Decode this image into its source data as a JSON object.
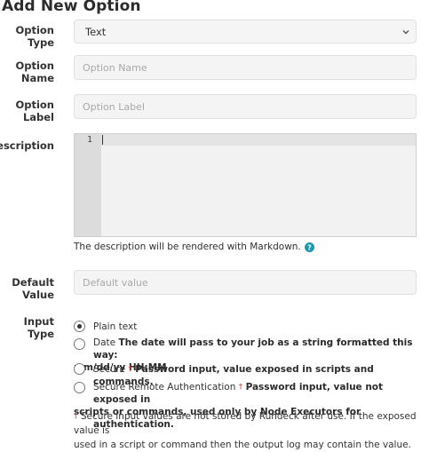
{
  "title": "Add New Option",
  "fields": {
    "option_type": {
      "label": "Option Type",
      "value": "Text"
    },
    "option_name": {
      "label_line1": "Option",
      "label_line2": "Name",
      "placeholder": "Option Name"
    },
    "option_label": {
      "label_line1": "Option",
      "label_line2": "Label",
      "placeholder": "Option Label"
    },
    "description": {
      "label": "Description",
      "line_number": "1",
      "help": "The description will be rendered with Markdown."
    },
    "default_value": {
      "label_line1": "Default",
      "label_line2": "Value",
      "placeholder": "Default value"
    }
  },
  "input_type": {
    "label": "Input Type",
    "options": [
      {
        "label": "Plain text",
        "description": "",
        "checked": true
      },
      {
        "label": "Date",
        "description_line1": "The date will pass to your job as a string formatted this way:",
        "description_line2": "mm/dd/yy HH:MM",
        "checked": false
      },
      {
        "label": "Secure",
        "dagger": "†",
        "description": "Password input, value exposed in scripts and commands.",
        "checked": false
      },
      {
        "label": "Secure Remote Authentication",
        "dagger": "†",
        "description_line1": "Password input, value not exposed in",
        "description_line2": "scripts or commands, used only by Node Executors for authentication.",
        "checked": false
      }
    ],
    "note_dagger": "†",
    "note_line1": "Secure input values are not stored by Rundeck after use. If the exposed value is",
    "note_line2": "used in a script or command then the output log may contain the value."
  },
  "colors": {
    "dagger": "#c0392b",
    "help_icon": "#1a9bb0"
  },
  "icons": [
    "chevron-down-icon",
    "question-circle-icon"
  ]
}
